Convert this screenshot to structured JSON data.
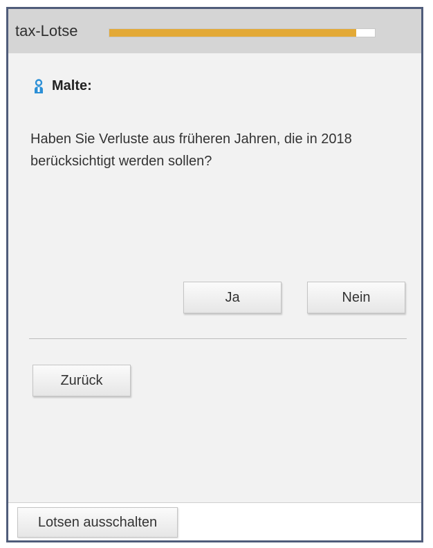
{
  "window": {
    "title": "tax-Lotse",
    "progress_fraction": 0.93,
    "progress_color": "#e3a936"
  },
  "dialog": {
    "speaker_icon": "person-icon",
    "speaker_name": "Malte:",
    "question": "Haben Sie Verluste aus früheren Jahren, die in 2018 berücksichtigt werden sollen?",
    "buttons": {
      "yes": "Ja",
      "no": "Nein",
      "back": "Zurück"
    }
  },
  "footer": {
    "turn_off_label": "Lotsen ausschalten"
  }
}
